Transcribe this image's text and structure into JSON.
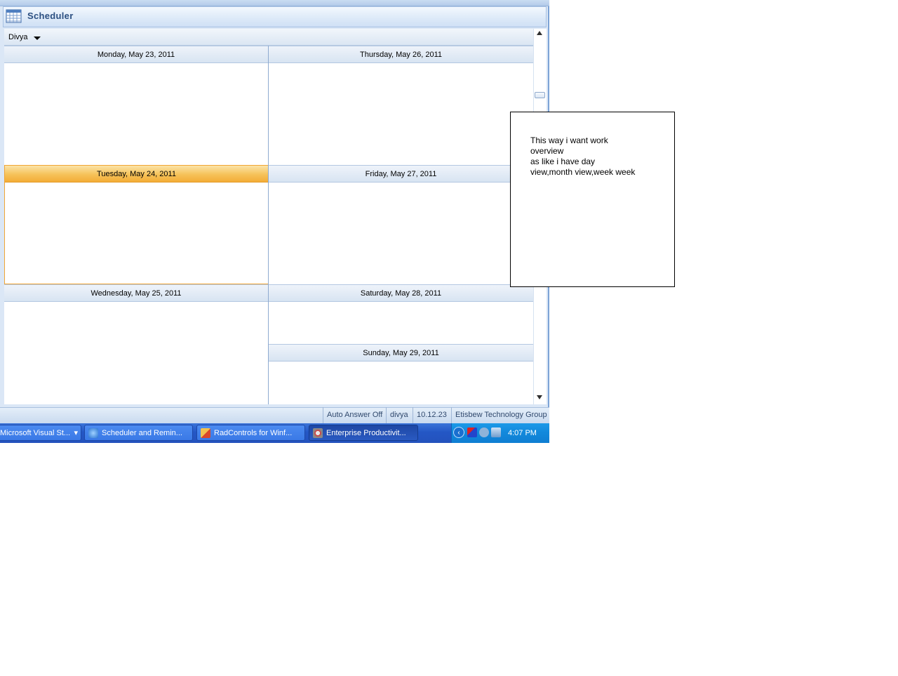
{
  "window": {
    "title": "Scheduler"
  },
  "resource": {
    "selected": "Divya"
  },
  "days": {
    "mon": "Monday, May 23, 2011",
    "tue": "Tuesday, May 24, 2011",
    "wed": "Wednesday, May 25, 2011",
    "thu": "Thursday, May 26, 2011",
    "fri": "Friday, May 27, 2011",
    "sat": "Saturday, May 28, 2011",
    "sun": "Sunday, May 29, 2011"
  },
  "statusbar": {
    "auto_answer": "Auto Answer Off",
    "user": "divya",
    "version": "10.12.23",
    "company": "Etisbew Technology Group"
  },
  "taskbar": {
    "items": [
      "Microsoft Visual St...",
      "Scheduler and Remin...",
      "RadControls for Winf...",
      "Enterprise Productivit..."
    ],
    "clock": "4:07 PM"
  },
  "note": {
    "text": "This way i want work\noverview\nas like i have day\nview,month view,week week"
  },
  "colors": {
    "today_header": "#f6c259",
    "grid_line": "#8eaad0",
    "taskbar": "#2457c5",
    "tray": "#1289dc"
  }
}
